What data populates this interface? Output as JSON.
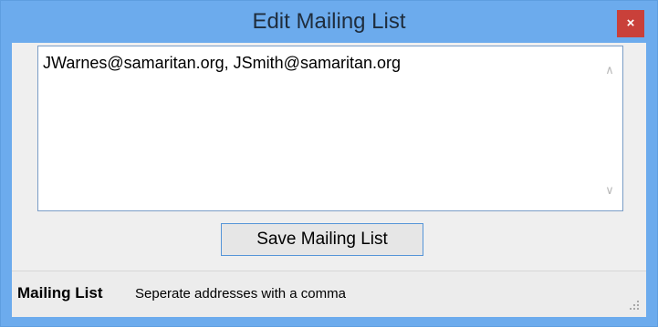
{
  "window": {
    "title": "Edit Mailing List",
    "close_label": "×"
  },
  "mailing_list": {
    "value": "JWarnes@samaritan.org, JSmith@samaritan.org"
  },
  "save_button": {
    "label": "Save Mailing List"
  },
  "statusbar": {
    "label": "Mailing List",
    "hint": "Seperate addresses with a comma"
  },
  "colors": {
    "titlebar": "#6cabed",
    "close_button": "#c9403a",
    "button_border": "#5595d8"
  }
}
